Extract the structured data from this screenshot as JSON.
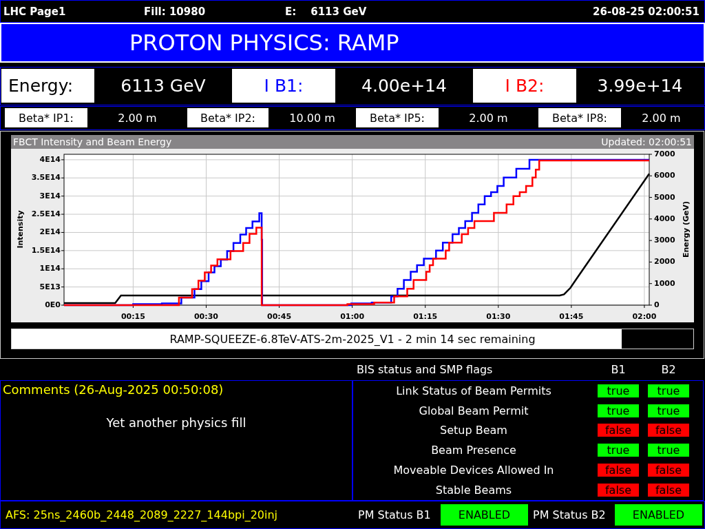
{
  "header": {
    "page": "LHC Page1",
    "fill": "Fill: 10980",
    "energy_label": "E:",
    "energy": "6113 GeV",
    "timestamp": "26-08-25 02:00:51"
  },
  "title": "PROTON PHYSICS: RAMP",
  "summary": [
    {
      "label": "Energy:",
      "value": "6113 GeV",
      "color": "#000000"
    },
    {
      "label": "I B1:",
      "value": "4.00e+14",
      "color": "#0000ff"
    },
    {
      "label": "I B2:",
      "value": "3.99e+14",
      "color": "#ff0000"
    }
  ],
  "beta_star": [
    {
      "label": "Beta* IP1:",
      "value": "2.00 m"
    },
    {
      "label": "Beta* IP2:",
      "value": "10.00 m"
    },
    {
      "label": "Beta* IP5:",
      "value": "2.00 m"
    },
    {
      "label": "Beta* IP8:",
      "value": "2.00 m"
    }
  ],
  "chart": {
    "updated": "Updated: 02:00:51",
    "chart_data": {
      "type": "line",
      "title": "FBCT Intensity and Beam Energy",
      "ylabel": "Intensity",
      "y2label": "Energy (GeV)",
      "grid": true,
      "xlim": [
        0.8,
        121
      ],
      "ylim": [
        0,
        415000000000000.0
      ],
      "y2lim": [
        0,
        7000
      ],
      "xticks": [
        {
          "value": 15,
          "label": "00:15"
        },
        {
          "value": 30,
          "label": "00:30"
        },
        {
          "value": 45,
          "label": "00:45"
        },
        {
          "value": 60,
          "label": "01:00"
        },
        {
          "value": 75,
          "label": "01:15"
        },
        {
          "value": 90,
          "label": "01:30"
        },
        {
          "value": 105,
          "label": "01:45"
        },
        {
          "value": 120,
          "label": "02:00"
        }
      ],
      "yticks": [
        {
          "value": 0,
          "label": "0E0"
        },
        {
          "value": 50000000000000.0,
          "label": "5E13"
        },
        {
          "value": 100000000000000.0,
          "label": "1E14"
        },
        {
          "value": 150000000000000.0,
          "label": "1.5E14"
        },
        {
          "value": 200000000000000.0,
          "label": "2E14"
        },
        {
          "value": 250000000000000.0,
          "label": "2.5E14"
        },
        {
          "value": 300000000000000.0,
          "label": "3E14"
        },
        {
          "value": 350000000000000.0,
          "label": "3.5E14"
        },
        {
          "value": 400000000000000.0,
          "label": "4E14"
        }
      ],
      "y2ticks": [
        0,
        1000,
        2000,
        3000,
        4000,
        5000,
        6000,
        7000
      ],
      "series": [
        {
          "color": "#000000",
          "axis": "y2",
          "x": [
            0.8,
            11.3,
            12.5,
            102.6,
            103.5,
            104.8,
            106.0,
            121
          ],
          "values": [
            100,
            100,
            450,
            450,
            500,
            800,
            1200,
            6100
          ]
        },
        {
          "color": "#0000ff",
          "x": [
            0.8,
            15.0,
            15.0,
            20.9,
            20.9,
            24.9,
            24.9,
            27.6,
            27.6,
            29.0,
            29.0,
            30.5,
            30.5,
            31.7,
            31.7,
            33.0,
            33.0,
            34.3,
            34.3,
            35.6,
            35.6,
            37.0,
            37.0,
            38.2,
            38.2,
            39.5,
            39.5,
            40.9,
            40.9,
            41.4,
            41.4,
            41.5,
            41.5,
            59.8,
            59.8,
            64.0,
            64.0,
            68.0,
            68.0,
            69.3,
            69.3,
            70.6,
            70.6,
            72.0,
            72.0,
            73.3,
            73.3,
            74.7,
            74.7,
            77.2,
            77.2,
            78.6,
            78.6,
            80.6,
            80.6,
            81.9,
            81.9,
            83.2,
            83.2,
            84.6,
            84.6,
            85.9,
            85.9,
            87.2,
            87.2,
            88.5,
            88.5,
            89.8,
            89.8,
            91.1,
            91.1,
            93.7,
            93.7,
            96.4,
            96.4,
            121
          ],
          "values": [
            0,
            0,
            3000000000000.0,
            3000000000000.0,
            5000000000000.0,
            5000000000000.0,
            21000000000000.0,
            21000000000000.0,
            44000000000000.0,
            44000000000000.0,
            66000000000000.0,
            66000000000000.0,
            90000000000000.0,
            90000000000000.0,
            107000000000000.0,
            107000000000000.0,
            125000000000000.0,
            125000000000000.0,
            149000000000000.0,
            149000000000000.0,
            171000000000000.0,
            171000000000000.0,
            194000000000000.0,
            194000000000000.0,
            212000000000000.0,
            212000000000000.0,
            230000000000000.0,
            230000000000000.0,
            253000000000000.0,
            253000000000000.0,
            180000000000000.0,
            180000000000000.0,
            0,
            0,
            5000000000000.0,
            5000000000000.0,
            7000000000000.0,
            7000000000000.0,
            24000000000000.0,
            24000000000000.0,
            45000000000000.0,
            45000000000000.0,
            69000000000000.0,
            69000000000000.0,
            92000000000000.0,
            92000000000000.0,
            110000000000000.0,
            110000000000000.0,
            128000000000000.0,
            128000000000000.0,
            150000000000000.0,
            150000000000000.0,
            172000000000000.0,
            172000000000000.0,
            195000000000000.0,
            195000000000000.0,
            212000000000000.0,
            212000000000000.0,
            231000000000000.0,
            231000000000000.0,
            254000000000000.0,
            254000000000000.0,
            277000000000000.0,
            277000000000000.0,
            300000000000000.0,
            300000000000000.0,
            311000000000000.0,
            311000000000000.0,
            328000000000000.0,
            328000000000000.0,
            351000000000000.0,
            351000000000000.0,
            375000000000000.0,
            375000000000000.0,
            400000000000000.0,
            400000000000000.0
          ]
        },
        {
          "color": "#ff0000",
          "x": [
            0.8,
            24.4,
            24.4,
            27.1,
            27.1,
            28.4,
            28.4,
            29.7,
            29.7,
            31.0,
            31.0,
            32.3,
            32.3,
            35.0,
            35.0,
            37.6,
            37.6,
            38.9,
            38.9,
            40.3,
            40.3,
            41.4,
            41.4,
            59.0,
            59.0,
            64.5,
            64.5,
            68.6,
            68.6,
            71.3,
            71.3,
            72.6,
            72.6,
            75.2,
            75.2,
            75.9,
            75.9,
            76.6,
            76.6,
            79.2,
            79.2,
            79.9,
            79.9,
            82.5,
            82.5,
            83.8,
            83.8,
            85.1,
            85.1,
            89.1,
            89.1,
            91.7,
            91.7,
            93.1,
            93.1,
            94.4,
            94.4,
            95.7,
            95.7,
            97.0,
            97.0,
            97.7,
            97.7,
            98.4,
            98.4,
            121
          ],
          "values": [
            0,
            0,
            21000000000000.0,
            21000000000000.0,
            44000000000000.0,
            44000000000000.0,
            67000000000000.0,
            67000000000000.0,
            90000000000000.0,
            90000000000000.0,
            109000000000000.0,
            109000000000000.0,
            126000000000000.0,
            126000000000000.0,
            149000000000000.0,
            149000000000000.0,
            171000000000000.0,
            171000000000000.0,
            196000000000000.0,
            196000000000000.0,
            213000000000000.0,
            213000000000000.0,
            0,
            0,
            3000000000000.0,
            3000000000000.0,
            7000000000000.0,
            7000000000000.0,
            24000000000000.0,
            24000000000000.0,
            45000000000000.0,
            45000000000000.0,
            69000000000000.0,
            69000000000000.0,
            92000000000000.0,
            92000000000000.0,
            110000000000000.0,
            110000000000000.0,
            128000000000000.0,
            128000000000000.0,
            150000000000000.0,
            150000000000000.0,
            172000000000000.0,
            172000000000000.0,
            195000000000000.0,
            195000000000000.0,
            212000000000000.0,
            212000000000000.0,
            231000000000000.0,
            231000000000000.0,
            254000000000000.0,
            254000000000000.0,
            277000000000000.0,
            277000000000000.0,
            300000000000000.0,
            300000000000000.0,
            311000000000000.0,
            311000000000000.0,
            328000000000000.0,
            328000000000000.0,
            351000000000000.0,
            351000000000000.0,
            373000000000000.0,
            373000000000000.0,
            398000000000000.0,
            398000000000000.0
          ]
        }
      ]
    }
  },
  "progress": {
    "text": "RAMP-SQUEEZE-6.8TeV-ATS-2m-2025_V1 - 2 min 14 sec remaining",
    "level": 0.895
  },
  "bis": {
    "title": "BIS status and SMP flags",
    "columns": [
      "B1",
      "B2"
    ],
    "flags": [
      {
        "name": "Link Status of Beam Permits",
        "values": [
          {
            "text": "true",
            "on": true
          },
          {
            "text": "true",
            "on": true
          }
        ]
      },
      {
        "name": "Global Beam Permit",
        "values": [
          {
            "text": "true",
            "on": true
          },
          {
            "text": "true",
            "on": true
          }
        ]
      },
      {
        "name": "Setup Beam",
        "values": [
          {
            "text": "false",
            "on": false
          },
          {
            "text": "false",
            "on": false
          }
        ]
      },
      {
        "name": "Beam Presence",
        "values": [
          {
            "text": "true",
            "on": true
          },
          {
            "text": "true",
            "on": true
          }
        ]
      },
      {
        "name": "Moveable Devices Allowed In",
        "values": [
          {
            "text": "false",
            "on": false
          },
          {
            "text": "false",
            "on": false
          }
        ]
      },
      {
        "name": "Stable Beams",
        "values": [
          {
            "text": "false",
            "on": false
          },
          {
            "text": "false",
            "on": false
          }
        ]
      }
    ]
  },
  "comments": {
    "title": "Comments (26-Aug-2025 00:50:08)",
    "text": "Yet another physics fill"
  },
  "footer": {
    "afs": "AFS: 25ns_2460b_2448_2089_2227_144bpi_20inj",
    "pm_status": [
      {
        "label": "PM Status B1",
        "value": "ENABLED",
        "on": true
      },
      {
        "label": "PM Status B2",
        "value": "ENABLED",
        "on": true
      }
    ]
  }
}
